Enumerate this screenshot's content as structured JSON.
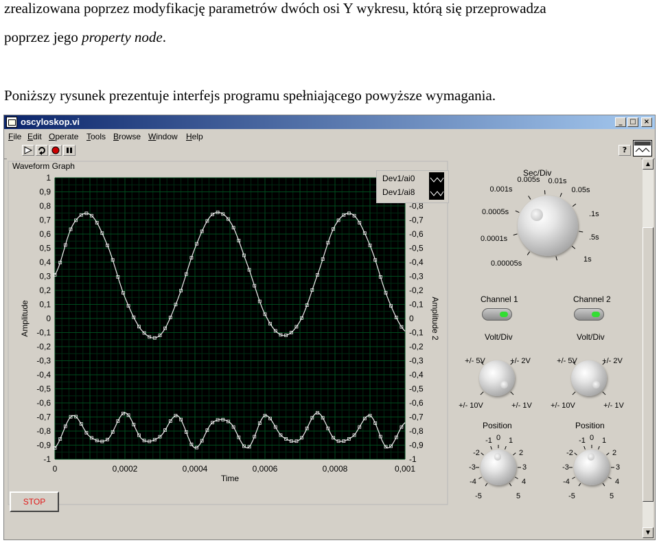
{
  "document": {
    "line1": "zrealizowana poprzez modyfikację parametrów dwóch osi Y wykresu, którą się przeprowadza",
    "line2_prefix": "poprzez jego ",
    "line2_italic": "property node",
    "line2_suffix": ".",
    "line3": "Poniższy rysunek prezentuje interfejs programu spełniającego powyższe wymagania."
  },
  "window": {
    "title": "oscyloskop.vi",
    "controls": [
      "_",
      "□",
      "×"
    ]
  },
  "menu": [
    "File",
    "Edit",
    "Operate",
    "Tools",
    "Browse",
    "Window",
    "Help"
  ],
  "toolbar": {
    "icons": [
      "run-arrow-icon",
      "run-continuously-icon",
      "abort-icon",
      "pause-icon"
    ],
    "help_label": "?"
  },
  "graph": {
    "title": "Waveform Graph",
    "x_label": "Time",
    "y_label": "Amplitude",
    "y2_label": "Amplitude 2",
    "legend": [
      "Dev1/ai0",
      "Dev1/ai8"
    ]
  },
  "chart_data": {
    "type": "line",
    "title": "Waveform Graph",
    "xlabel": "Time",
    "ylabel": "Amplitude",
    "y2label": "Amplitude 2",
    "xlim": [
      0,
      0.001
    ],
    "ylim": [
      -1,
      1
    ],
    "x_ticks": [
      "0",
      "0,0002",
      "0,0004",
      "0,0006",
      "0,0008",
      "0,001"
    ],
    "y_ticks": [
      "1",
      "0,9",
      "0,8",
      "0,7",
      "0,6",
      "0,5",
      "0,4",
      "0,3",
      "0,2",
      "0,1",
      "0",
      "-0,1",
      "-0,2",
      "-0,3",
      "-0,4",
      "-0,5",
      "-0,6",
      "-0,7",
      "-0,8",
      "-0,9",
      "-1"
    ],
    "y2_ticks": [
      "-0,8",
      "-0,7",
      "-0,6",
      "-0,5",
      "-0,4",
      "-0,3",
      "-0,2",
      "-0,1",
      "0",
      "-0,1",
      "-0,2",
      "-0,3",
      "-0,4",
      "-0,5",
      "-0,6",
      "-0,7",
      "-0,8",
      "-0,9",
      "-1"
    ],
    "grid": true,
    "legend_position": "top-right",
    "series": [
      {
        "name": "Dev1/ai0",
        "x": [
          0,
          5e-05,
          0.0001,
          0.00015,
          0.0002,
          0.00025,
          0.0003,
          0.00035,
          0.0004,
          0.00045,
          0.0005,
          0.00055,
          0.0006,
          0.00065,
          0.0007,
          0.00075,
          0.0008,
          0.00085,
          0.0009,
          0.00095,
          0.001
        ],
        "y": [
          0.31,
          0.66,
          0.74,
          0.52,
          0.15,
          -0.09,
          -0.12,
          0.13,
          0.5,
          0.74,
          0.69,
          0.38,
          0.03,
          -0.12,
          -0.02,
          0.31,
          0.66,
          0.74,
          0.52,
          0.15,
          -0.09
        ]
      },
      {
        "name": "Dev1/ai8",
        "x": [
          0,
          5e-05,
          0.0001,
          0.00015,
          0.0002,
          0.00025,
          0.0003,
          0.00035,
          0.0004,
          0.00045,
          0.0005,
          0.00055,
          0.0006,
          0.00065,
          0.0007,
          0.00075,
          0.0008,
          0.00085,
          0.0009,
          0.00095,
          0.001
        ],
        "y": [
          -0.92,
          -0.69,
          -0.84,
          -0.86,
          -0.67,
          -0.86,
          -0.84,
          -0.69,
          -0.92,
          -0.74,
          -0.74,
          -0.92,
          -0.69,
          -0.84,
          -0.86,
          -0.67,
          -0.86,
          -0.84,
          -0.69,
          -0.92,
          -0.74
        ]
      }
    ]
  },
  "controls": {
    "sec_div": {
      "label": "Sec/Div",
      "scale": [
        "0.00005s",
        "0.0001s",
        "0.0005s",
        "0.001s",
        "0.005s",
        "0.01s",
        "0.05s",
        ".1s",
        ".5s",
        "1s"
      ]
    },
    "channel1": {
      "label": "Channel 1",
      "volt_div_label": "Volt/Div",
      "volt_scale": [
        "+/- 5V",
        "+/- 2V",
        "+/- 10V",
        "+/- 1V"
      ],
      "position_label": "Position",
      "position_scale": [
        "-1",
        "0",
        "1",
        "-2",
        "2",
        "-3",
        "3",
        "-4",
        "4",
        "-5",
        "5"
      ]
    },
    "channel2": {
      "label": "Channel 2",
      "volt_div_label": "Volt/Div",
      "volt_scale": [
        "+/- 5V",
        "+/- 2V",
        "+/- 10V",
        "+/- 1V"
      ],
      "position_label": "Position",
      "position_scale": [
        "-1",
        "0",
        "1",
        "-2",
        "2",
        "-3",
        "3",
        "-4",
        "4",
        "-5",
        "5"
      ]
    },
    "stop_label": "STOP"
  },
  "colors": {
    "plot_bg": "#000000",
    "grid": "#004c1e",
    "trace": "#f0f0f0",
    "led_on": "#33dd33",
    "stop_text": "#e01818",
    "titlebar": "#0a246a"
  }
}
